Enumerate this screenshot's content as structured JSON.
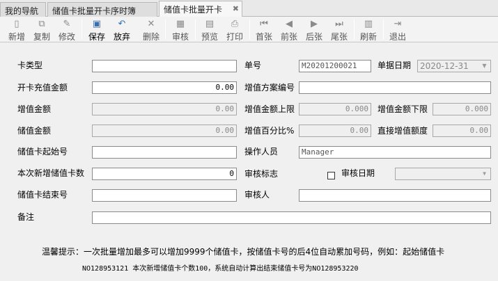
{
  "tabs": [
    {
      "label": "我的导航"
    },
    {
      "label": "储值卡批量开卡序时簿"
    },
    {
      "label": "储值卡批量开卡"
    }
  ],
  "toolbar": {
    "new": "新增",
    "copy": "复制",
    "modify": "修改",
    "save": "保存",
    "abandon": "放弃",
    "delete": "删除",
    "audit": "审核",
    "preview": "预览",
    "print": "打印",
    "first": "首张",
    "prev": "前张",
    "next": "后张",
    "last": "尾张",
    "refresh": "刷新",
    "exit": "退出"
  },
  "form": {
    "card_type": {
      "label": "卡类型",
      "value": ""
    },
    "bill_no": {
      "label": "单号",
      "value": "M20201200021"
    },
    "bill_date": {
      "label": "单据日期",
      "value": "2020-12-31"
    },
    "open_amount": {
      "label": "开卡充值金额",
      "value": "0.00"
    },
    "plan_no": {
      "label": "增值方案编号",
      "value": ""
    },
    "bonus_amount": {
      "label": "增值金额",
      "value": "0.00"
    },
    "bonus_upper": {
      "label": "增值金额上限",
      "value": "0.000"
    },
    "bonus_lower": {
      "label": "增值金额下限",
      "value": "0.000"
    },
    "stored_amount": {
      "label": "储值金额",
      "value": "0.00"
    },
    "bonus_percent": {
      "label": "增值百分比%",
      "value": "0.00"
    },
    "direct_bonus": {
      "label": "直接增值额度",
      "value": "0.00"
    },
    "start_no": {
      "label": "储值卡起始号",
      "value": ""
    },
    "operator": {
      "label": "操作人员",
      "value": "Manager"
    },
    "new_count": {
      "label": "本次新增储值卡数",
      "value": "0"
    },
    "audit_flag": {
      "label": "审核标志"
    },
    "audit_date": {
      "label": "审核日期",
      "value": ""
    },
    "end_no": {
      "label": "储值卡结束号",
      "value": ""
    },
    "auditor": {
      "label": "审核人",
      "value": ""
    },
    "remark": {
      "label": "备注",
      "value": ""
    }
  },
  "hint": {
    "line1": "温馨提示：一次批量增加最多可以增加9999个储值卡，按储值卡号的后4位自动累加号码，例如：起始储值卡",
    "line2": "NO128953121 本次新增储值卡个数100，系统自动计算出结束储值卡号为NO128953220"
  }
}
